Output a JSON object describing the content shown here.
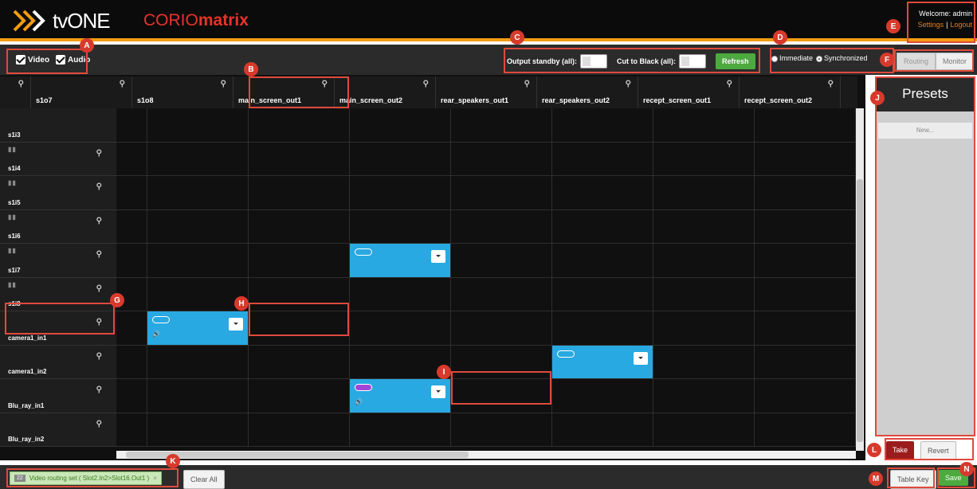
{
  "header": {
    "brand": "tvONE",
    "product_prefix": "CORIO",
    "product_suffix": "matrix",
    "welcome": "Welcome: admin",
    "settings_link": "Settings",
    "separator": "|",
    "logout_link": "Logout"
  },
  "toolbar": {
    "video_label": "Video",
    "audio_label": "Audio",
    "output_standby_label": "Output standby (all):",
    "cut_to_black_label": "Cut to Black (all):",
    "refresh_label": "Refresh",
    "immediate_label": "Immediate",
    "synchronized_label": "Synchronized",
    "routing_label": "Routing",
    "monitor_label": "Monitor"
  },
  "columns": [
    "s1o7",
    "s1o8",
    "main_screen_out1",
    "main_screen_out2",
    "rear_speakers_out1",
    "rear_speakers_out2",
    "recept_screen_out1",
    "recept_screen_out2"
  ],
  "rows": [
    "s1i3",
    "s1i4",
    "s1i5",
    "s1i6",
    "s1i7",
    "s1i8",
    "camera1_in1",
    "camera1_in2",
    "Blu_ray_in1",
    "Blu_ray_in2"
  ],
  "presets": {
    "title": "Presets",
    "new_label": "New...",
    "take_label": "Take",
    "revert_label": "Revert"
  },
  "footer": {
    "notification_count": "22",
    "notification_text": "Video routing set ( Slot2.In2>Slot16.Out1 )",
    "close_glyph": "×",
    "clear_all_label": "Clear All",
    "table_key_label": "Table Key",
    "save_label": "Save"
  },
  "annotations": [
    "A",
    "B",
    "C",
    "D",
    "E",
    "F",
    "G",
    "H",
    "I",
    "J",
    "K",
    "L",
    "M",
    "N"
  ],
  "colors": {
    "accent": "#f39c12",
    "brand_red": "#e8322b",
    "route_blue": "#29a9e1",
    "refresh_green": "#4caa3f",
    "take_red": "#9b1c1c",
    "callout_red": "#d73a2c"
  }
}
